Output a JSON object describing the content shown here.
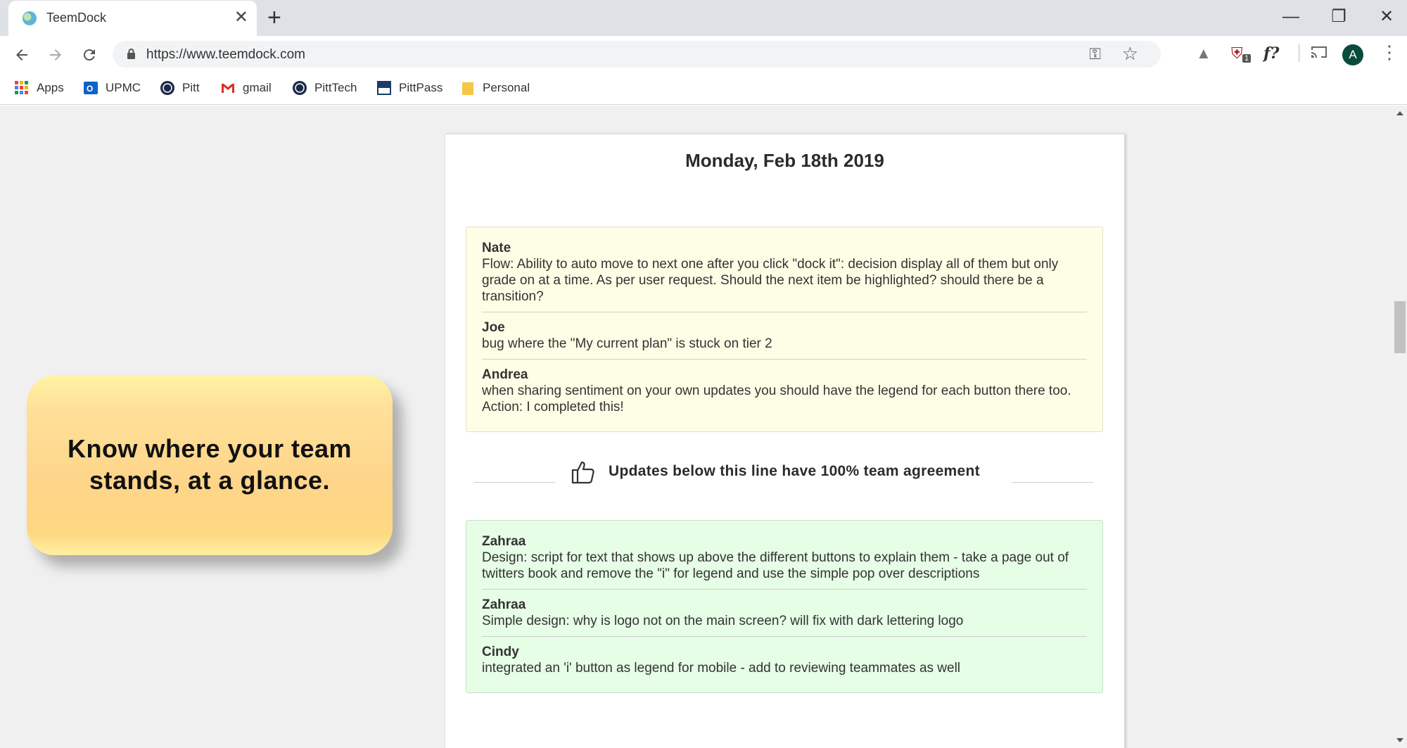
{
  "browser": {
    "tab_title": "TeemDock",
    "tab_close": "✕",
    "new_tab": "+",
    "url": "https://www.teemdock.com",
    "window_controls": {
      "minimize": "—",
      "restore": "❐",
      "close": "✕"
    },
    "extension_badge": "1",
    "fx_label": "f?",
    "avatar_letter": "A",
    "bookmarks": [
      {
        "label": "Apps",
        "icon": "apps-grid-icon"
      },
      {
        "label": "UPMC",
        "icon": "outlook-icon"
      },
      {
        "label": "Pitt",
        "icon": "pitt-seal-icon"
      },
      {
        "label": "gmail",
        "icon": "gmail-icon"
      },
      {
        "label": "PittTech",
        "icon": "pitt-seal-icon"
      },
      {
        "label": "PittPass",
        "icon": "pittpass-icon"
      },
      {
        "label": "Personal",
        "icon": "folder-icon"
      }
    ]
  },
  "page": {
    "date_heading": "Monday, Feb 18th 2019",
    "pending_updates": [
      {
        "author": "Nate",
        "text": "Flow: Ability to auto move to next one after you click \"dock it\": decision display all of them but only grade on at a time. As per user request. Should the next item be highlighted? should there be a transition?"
      },
      {
        "author": "Joe",
        "text": "bug where the \"My current plan\" is stuck on tier 2"
      },
      {
        "author": "Andrea",
        "text": "when sharing sentiment on your own updates you should have the legend for each button there too. Action: I completed this!"
      }
    ],
    "agreement_label": "Updates below this line have 100% team agreement",
    "agreed_updates": [
      {
        "author": "Zahraa",
        "text": "Design: script for text that shows up above the different buttons to explain them - take a page out of twitters book and remove the \"i\" for legend and use the simple pop over descriptions"
      },
      {
        "author": "Zahraa",
        "text": "Simple design: why is logo not on the main screen? will fix with dark lettering logo"
      },
      {
        "author": "Cindy",
        "text": "integrated an 'i' button as legend for mobile - add to reviewing teammates as well"
      }
    ],
    "callout": "Know where your team stands, at a glance."
  },
  "colors": {
    "pending_bg": "#fefee6",
    "agreed_bg": "#e6fde6",
    "callout_bg": "#fed589"
  }
}
